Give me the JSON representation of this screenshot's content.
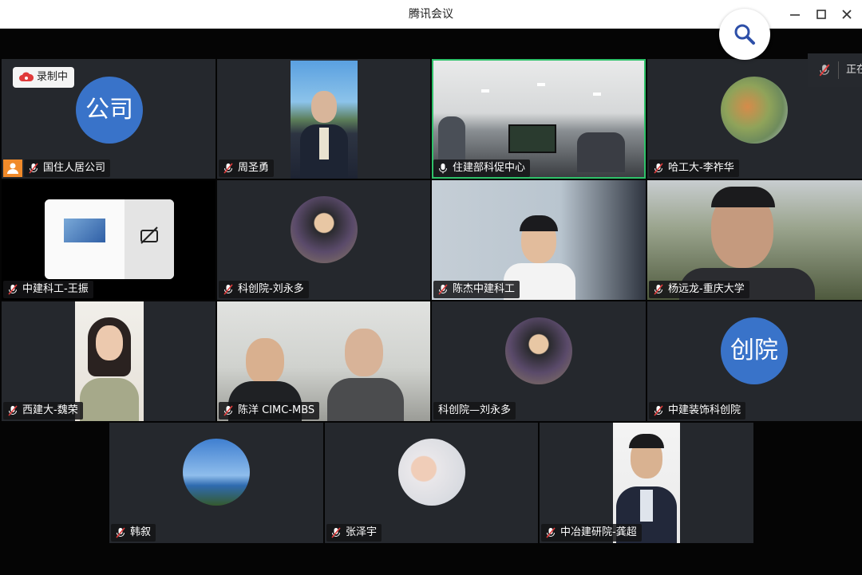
{
  "window": {
    "title": "腾讯会议"
  },
  "recording": {
    "label": "录制中"
  },
  "speaking_panel": {
    "label": "正在"
  },
  "participants": [
    {
      "name": "国住人居公司",
      "avatar_text": "公司"
    },
    {
      "name": "周圣勇"
    },
    {
      "name": "住建部科促中心"
    },
    {
      "name": "哈工大-李祚华"
    },
    {
      "name": "中建科工-王振"
    },
    {
      "name": "科创院-刘永多"
    },
    {
      "name": "陈杰中建科工"
    },
    {
      "name": "杨远龙-重庆大学"
    },
    {
      "name": "西建大-魏荣"
    },
    {
      "name": "陈洋 CIMC-MBS"
    },
    {
      "name": "科创院—刘永多"
    },
    {
      "name": "中建装饰科创院",
      "avatar_text": "创院"
    },
    {
      "name": "韩叙"
    },
    {
      "name": "张泽宇"
    },
    {
      "name": "中冶建研院-龚超"
    }
  ],
  "colors": {
    "accent": "#3973c9",
    "active_border": "#2fc26a",
    "host_badge": "#f08a2a"
  }
}
